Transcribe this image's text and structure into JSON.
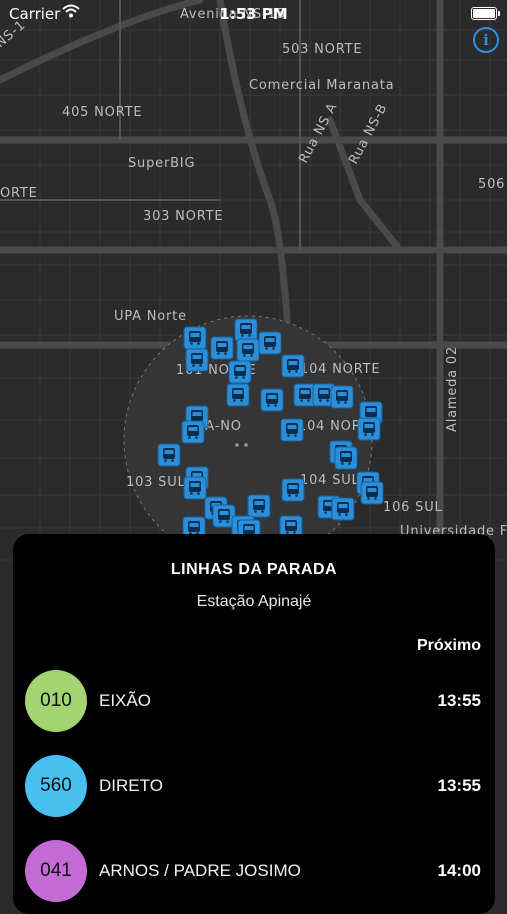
{
  "status_bar": {
    "carrier": "Carrier",
    "time": "1:53 PM"
  },
  "map": {
    "labels": [
      "Avenida NS-15",
      "503 NORTE",
      "Comercial Maranata",
      "405 NORTE",
      "Rua NS A",
      "Rua NS-B",
      "SuperBIG",
      "ORTE",
      "506",
      "303 NORTE",
      "UPA Norte",
      "101 NORTE",
      "104 NORTE",
      "SA-NO",
      "104 NORTE",
      "Alameda 02",
      "103 SUL",
      "104 SUL",
      "106 SUL",
      "Universidade Fe",
      "NS-1"
    ]
  },
  "sheet": {
    "title": "LINHAS DA PARADA",
    "stop_name": "Estação Apinajé",
    "next_header": "Próximo",
    "lines": [
      {
        "number": "010",
        "name": "EIXÃO",
        "next": "13:55",
        "color": "#a3d46f"
      },
      {
        "number": "560",
        "name": "DIRETO",
        "next": "13:55",
        "color": "#48c1f0"
      },
      {
        "number": "041",
        "name": "ARNOS / PADRE JOSIMO",
        "next": "14:00",
        "color": "#c56bd6"
      }
    ]
  },
  "colors": {
    "accent": "#2f8de4",
    "bus_marker": "#2a8fd8",
    "map_background": "#2b2b2b"
  }
}
